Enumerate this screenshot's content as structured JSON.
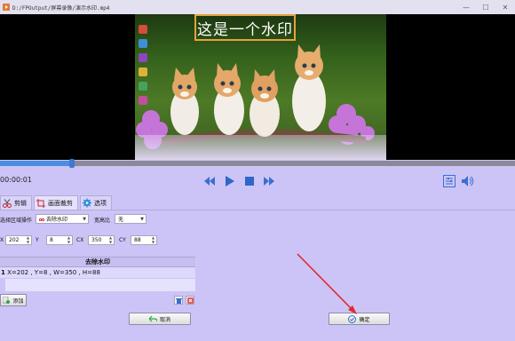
{
  "window": {
    "title": "D:/FPOutput/屏幕录像/演示水印.mp4",
    "min_icon": "minimize-icon",
    "max_icon": "maximize-icon",
    "close_icon": "close-icon"
  },
  "video": {
    "watermark_text": "这是一个水印"
  },
  "player": {
    "current_time": "00:00:01",
    "progress_fraction": 0.14,
    "controls": [
      "rewind-icon",
      "play-icon",
      "stop-icon",
      "fast-forward-icon"
    ],
    "right_controls": [
      "equalizer-icon",
      "volume-icon"
    ]
  },
  "tabs": [
    {
      "label": "剪辑",
      "icon": "scissors-icon"
    },
    {
      "label": "画面裁剪",
      "icon": "crop-icon",
      "active": true
    },
    {
      "label": "选项",
      "icon": "gear-icon"
    }
  ],
  "settings": {
    "area_op_label": "选择区域操作",
    "area_op_value": "去除水印",
    "aspect_label": "宽高比",
    "aspect_value": "无",
    "x_label": "X",
    "x_value": "202",
    "y_label": "Y",
    "y_value": "8",
    "w_label": "CX",
    "w_value": "350",
    "h_label": "CY",
    "h_value": "88"
  },
  "list": {
    "header": "去除水印",
    "rows": [
      {
        "index": "1",
        "text": "X=202 , Y=8 , W=350 , H=88"
      }
    ]
  },
  "buttons": {
    "add": "添加",
    "cancel": "取消",
    "ok": "确定"
  }
}
